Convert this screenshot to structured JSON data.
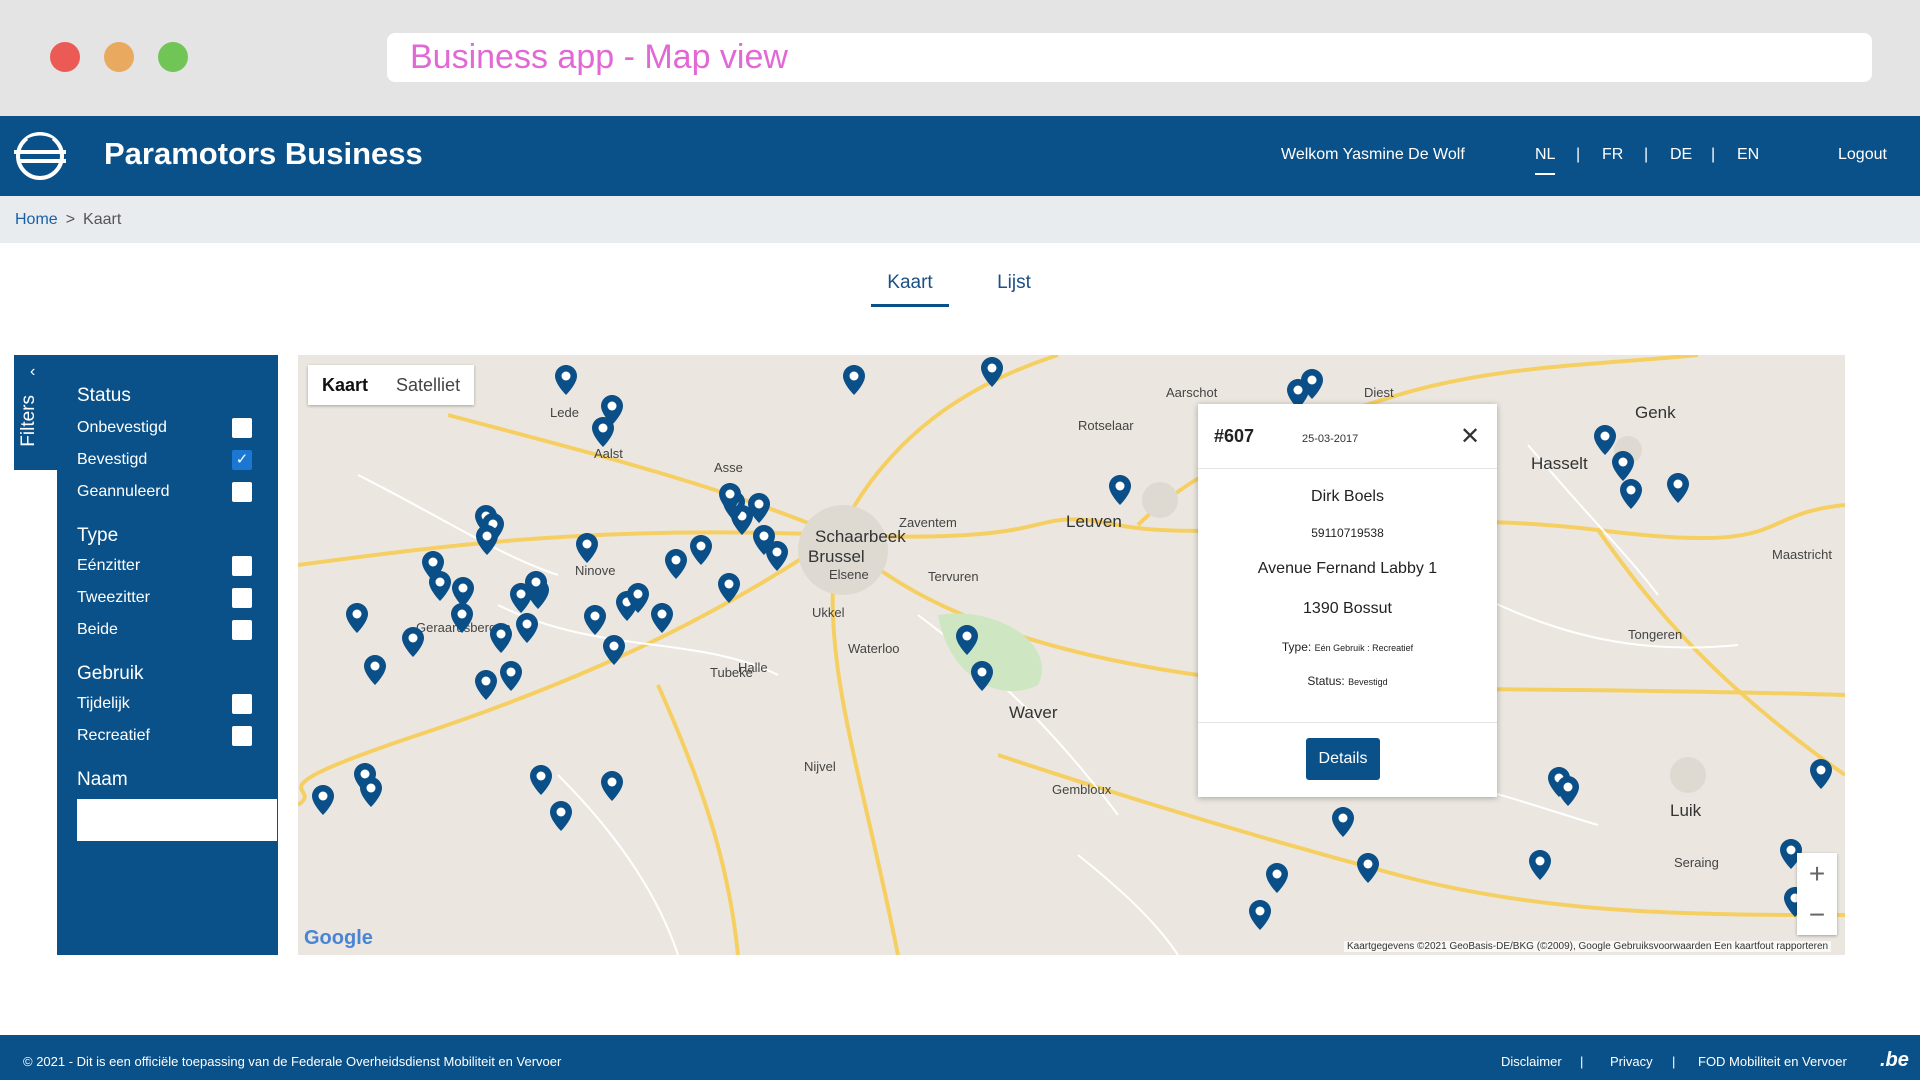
{
  "browser": {
    "url_title": "Business app - Map view"
  },
  "header": {
    "app_title": "Paramotors Business",
    "welcome": "Welkom Yasmine De Wolf",
    "languages": [
      "NL",
      "FR",
      "DE",
      "EN"
    ],
    "active_language": "NL",
    "separator": "|",
    "logout": "Logout"
  },
  "breadcrumb": {
    "home": "Home",
    "separator": ">",
    "current": "Kaart"
  },
  "tabs": [
    {
      "label": "Kaart",
      "active": true
    },
    {
      "label": "Lijst",
      "active": false
    }
  ],
  "filters": {
    "toggle_label": "Filters",
    "collapse_glyph": "‹",
    "status": {
      "title": "Status",
      "options": [
        {
          "label": "Onbevestigd",
          "checked": false
        },
        {
          "label": "Bevestigd",
          "checked": true
        },
        {
          "label": "Geannuleerd",
          "checked": false
        }
      ]
    },
    "type": {
      "title": "Type",
      "options": [
        {
          "label": "Eénzitter",
          "checked": false
        },
        {
          "label": "Tweezitter",
          "checked": false
        },
        {
          "label": "Beide",
          "checked": false
        }
      ]
    },
    "gebruik": {
      "title": "Gebruik",
      "options": [
        {
          "label": "Tijdelijk",
          "checked": false
        },
        {
          "label": "Recreatief",
          "checked": false
        }
      ]
    },
    "naam": {
      "title": "Naam",
      "value": ""
    }
  },
  "map": {
    "type_toggle": [
      "Kaart",
      "Satelliet"
    ],
    "selected_type": "Kaart",
    "zoom_in": "+",
    "zoom_out": "−",
    "logo": "Google",
    "attribution": "Kaartgegevens ©2021 GeoBasis-DE/BKG (©2009), Google  Gebruiksvoorwaarden  Een kaartfout rapporteren",
    "places": [
      "Brussel",
      "Schaarbeek",
      "Leuven",
      "Elsene",
      "Ukkel",
      "Aalst",
      "Waver",
      "Hasselt",
      "Genk",
      "Maastricht",
      "Luik",
      "Seraing",
      "Ninove",
      "Halle",
      "Zaventem",
      "Tervuren",
      "Geraardsbergen",
      "Lede",
      "Diest",
      "Tongeren",
      "Asse",
      "Aarschot",
      "Waterloo",
      "Gembloux",
      "Rotselaar",
      "Tubeke",
      "Nijvel"
    ],
    "pin_color": "#0b4f88"
  },
  "popup": {
    "id": "#607",
    "date": "25-03-2017",
    "close": "✕",
    "name": "Dirk Boels",
    "number": "59110719538",
    "street": "Avenue Fernand Labby 1",
    "city": "1390 Bossut",
    "type_label": "Type:",
    "type_value": "Eén Gebruik : Recreatief",
    "status_label": "Status:",
    "status_value": "Bevestigd",
    "button": "Details"
  },
  "footer": {
    "copyright": "© 2021 - Dit is een officiële toepassing van de Federale Overheidsdienst Mobiliteit en Vervoer",
    "links": [
      "Disclaimer",
      "Privacy",
      "FOD Mobiliteit en Vervoer"
    ],
    "separator": "|",
    "be_logo": ".be"
  },
  "colors": {
    "brand": "#0b5189",
    "url_text": "#e168d5",
    "map_bg": "#ebe7e0",
    "road_major": "#f6cf63"
  }
}
